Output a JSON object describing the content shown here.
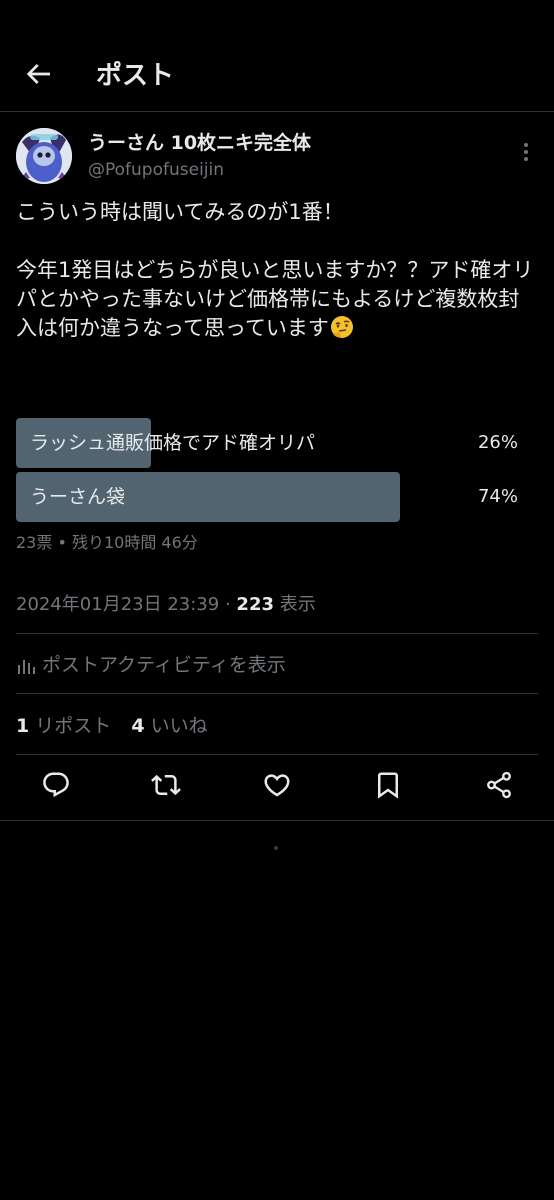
{
  "header": {
    "title": "ポスト",
    "back_icon": "arrow-left-icon"
  },
  "author": {
    "display_name": "うーさん 10枚ニキ完全体",
    "handle": "@Pofupofuseijin",
    "avatar_icon": "avatar-image",
    "more_icon": "more-vertical-icon"
  },
  "tweet": {
    "line1": "こういう時は聞いてみるのが1番！",
    "line2": "今年1発目はどちらが良いと思いますか？？アド確オリパとかやった事ないけど価格帯にもよるけど複数枚封入は何か違うなって思っています",
    "emoji": "thinking-face-emoji"
  },
  "poll": {
    "options": [
      {
        "label": "ラッシュ通販価格でアド確オリパ",
        "percent_label": "26%",
        "percent": 26
      },
      {
        "label": "うーさん袋",
        "percent_label": "74%",
        "percent": 74
      }
    ],
    "meta": "23票 • 残り10時間 46分"
  },
  "timestamp": {
    "datetime": "2024年01月23日 23:39",
    "separator": "·",
    "views_count": "223",
    "views_label": "表示"
  },
  "activity": {
    "label": "ポストアクティビティを表示",
    "icon": "analytics-icon"
  },
  "stats": {
    "reposts_count": "1",
    "reposts_label": "リポスト",
    "likes_count": "4",
    "likes_label": "いいね"
  },
  "actions": [
    "reply-icon",
    "repost-icon",
    "like-icon",
    "bookmark-icon",
    "share-icon"
  ],
  "colors": {
    "background": "#000000",
    "text": "#e7e9ea",
    "muted": "#71767b",
    "poll_bar": "#536471",
    "border": "#2f3336"
  }
}
